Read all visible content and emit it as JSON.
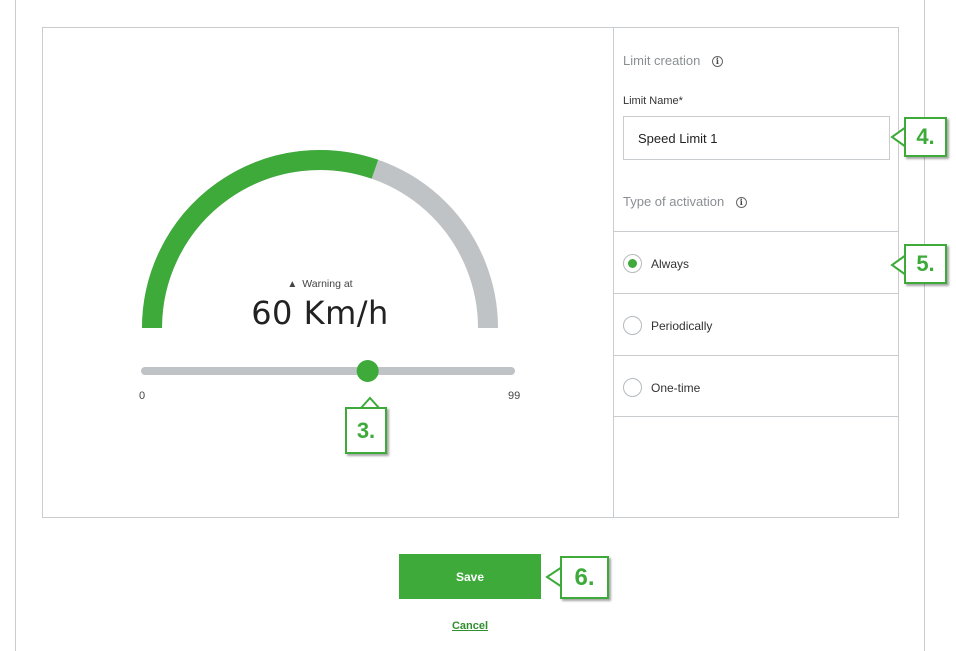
{
  "gauge": {
    "warning_label": "Warning at",
    "speed_value": "60 Km/h",
    "level_fraction": 0.606,
    "accent_color": "#3daa3a",
    "track_color": "#bfc3c5"
  },
  "slider": {
    "min_label": "0",
    "max_label": "99",
    "value": 60,
    "min": 0,
    "max": 99
  },
  "limit_creation": {
    "title": "Limit creation",
    "name_label": "Limit Name*",
    "name_value": "Speed Limit 1",
    "activation_title": "Type of activation",
    "options": [
      {
        "label": "Always",
        "checked": true
      },
      {
        "label": "Periodically",
        "checked": false
      },
      {
        "label": "One-time",
        "checked": false
      }
    ]
  },
  "actions": {
    "save_label": "Save",
    "cancel_label": "Cancel"
  },
  "callouts": {
    "c3": "3.",
    "c4": "4.",
    "c5": "5.",
    "c6": "6."
  },
  "icons": {
    "info": "info-icon",
    "warning": "warning-triangle-icon"
  }
}
